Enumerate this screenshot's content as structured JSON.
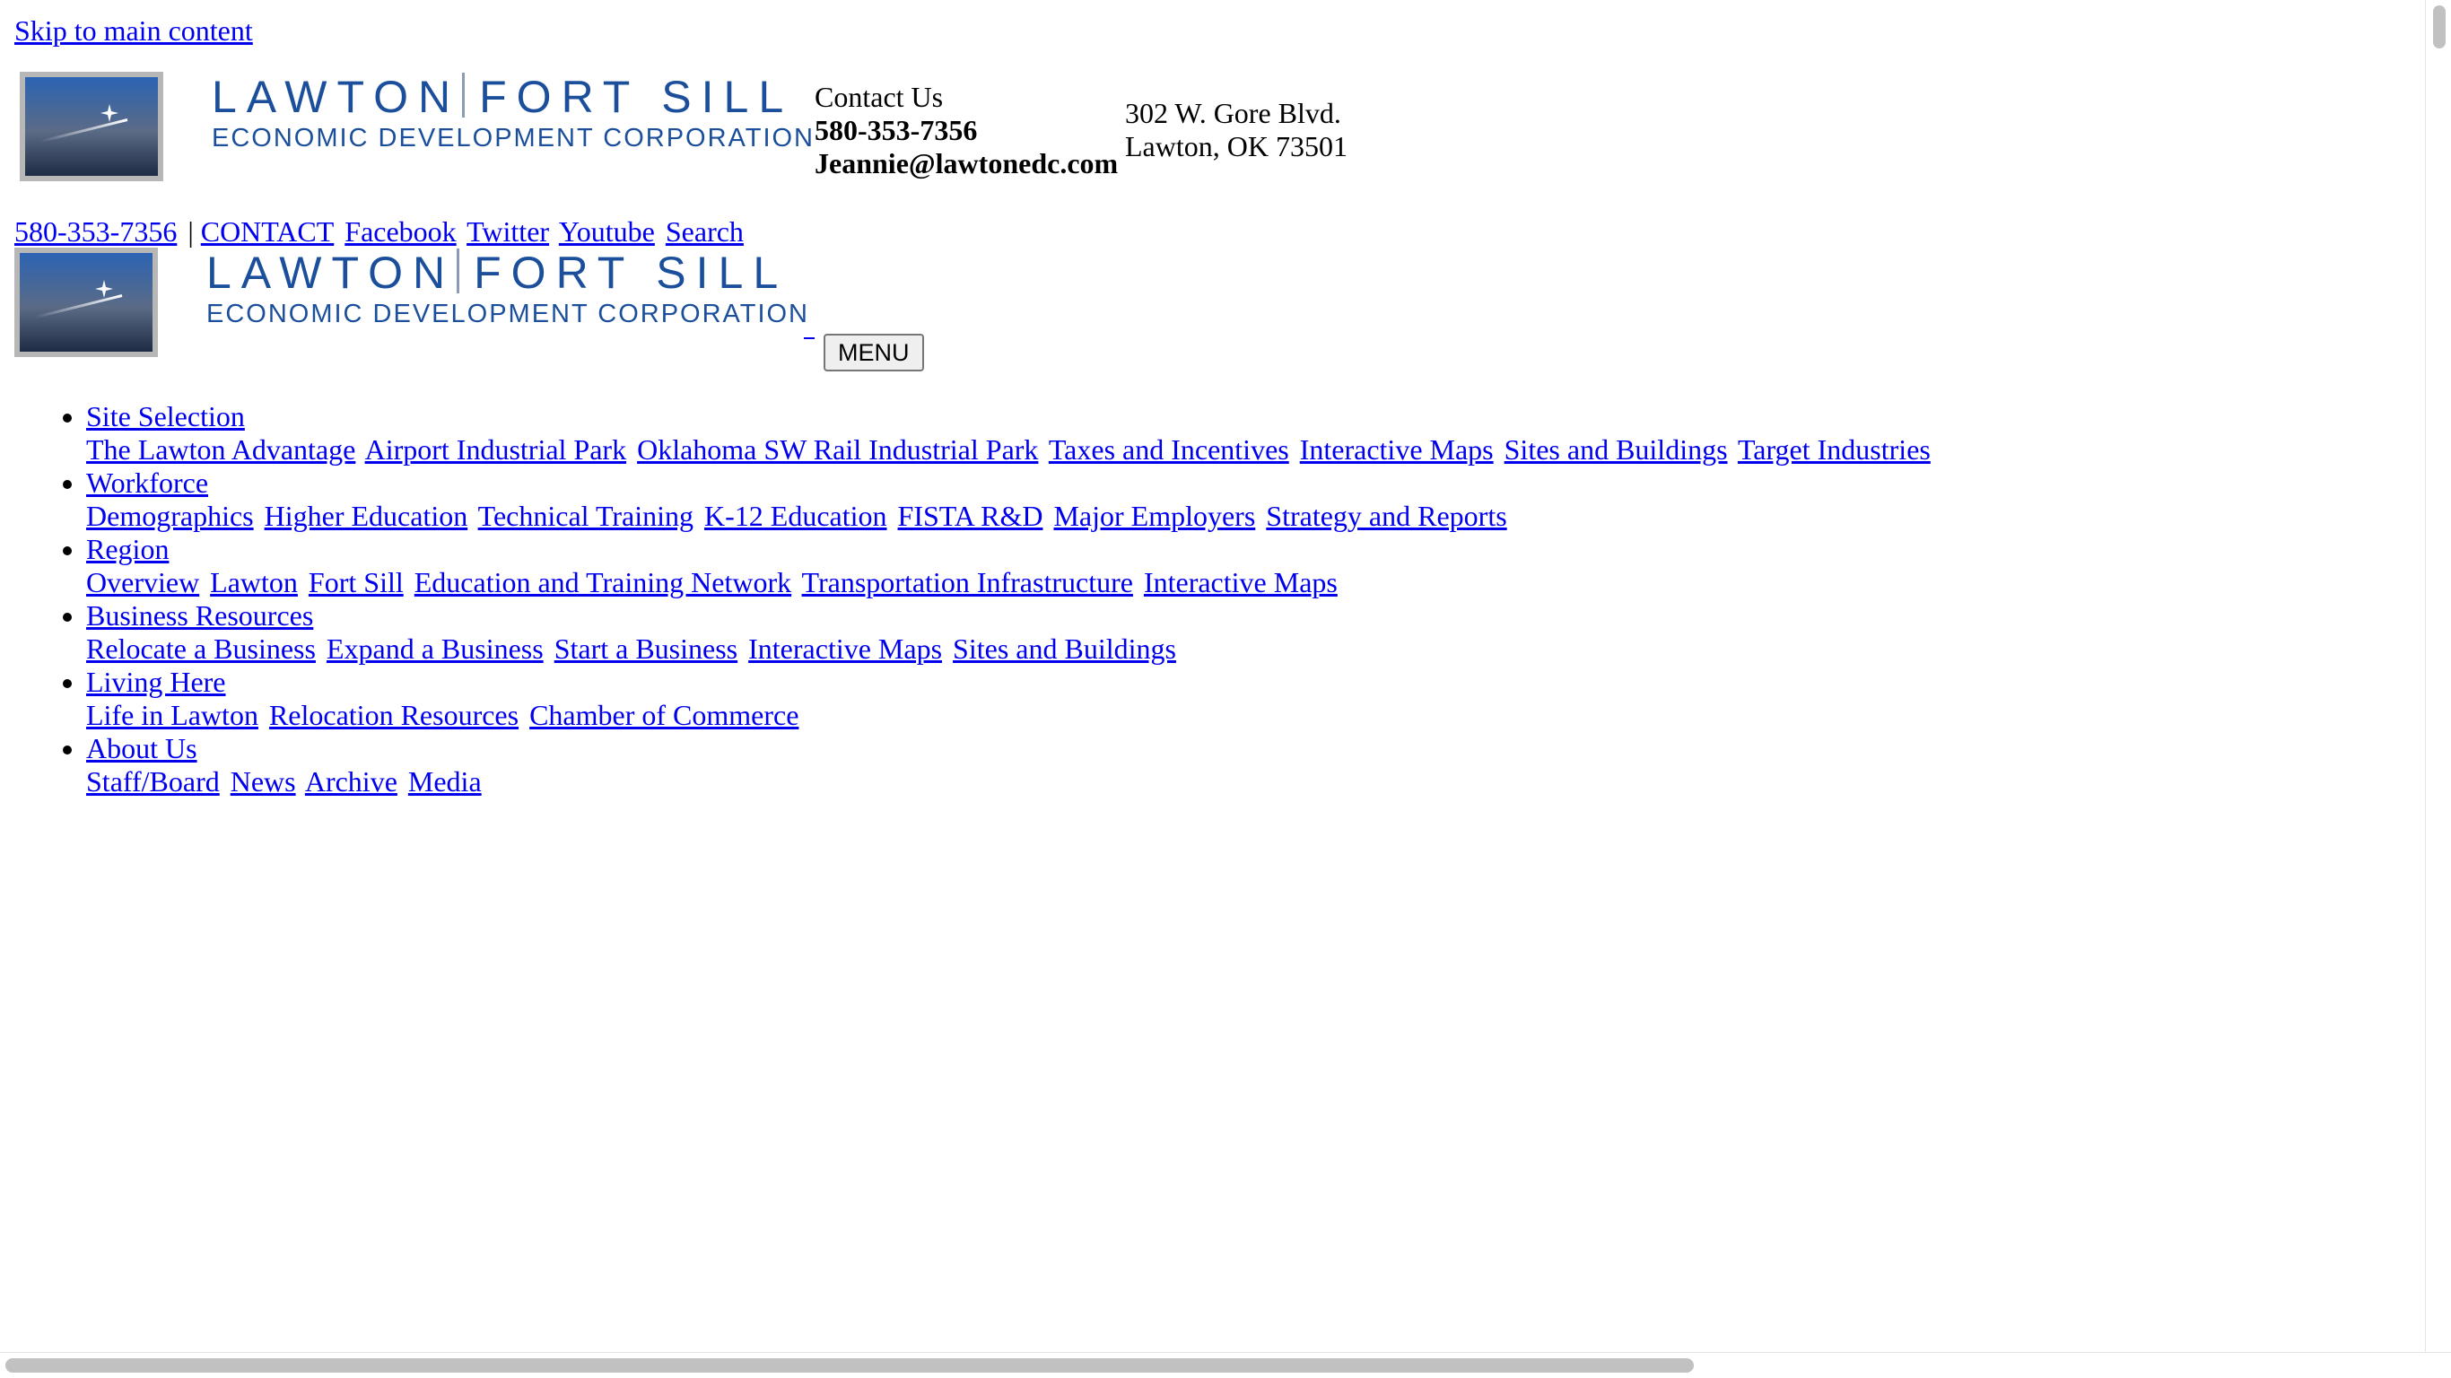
{
  "skip_link": "Skip to main content",
  "header": {
    "logo": {
      "line1_left": "LAWTON",
      "line1_right": "FORT SILL",
      "line2": "ECONOMIC DEVELOPMENT CORPORATION"
    },
    "contact": {
      "heading": "Contact Us",
      "phone": "580-353-7356",
      "email": "Jeannie@lawtonedc.com"
    },
    "address": {
      "line1": "302 W. Gore Blvd.",
      "line2": "Lawton, OK 73501"
    }
  },
  "utility_bar": {
    "phone": "580-353-7356",
    "separator": "|",
    "contact": "CONTACT",
    "facebook": "Facebook",
    "twitter": "Twitter",
    "youtube": "Youtube",
    "search": "Search"
  },
  "menu_button": "MENU",
  "nav": [
    {
      "label": "Site Selection",
      "children": [
        "The Lawton Advantage",
        "Airport Industrial Park",
        "Oklahoma SW Rail Industrial Park",
        "Taxes and Incentives",
        "Interactive Maps",
        "Sites and Buildings",
        "Target Industries"
      ]
    },
    {
      "label": "Workforce",
      "children": [
        "Demographics",
        "Higher Education",
        "Technical Training",
        "K-12 Education",
        "FISTA R&D",
        "Major Employers",
        "Strategy and Reports"
      ]
    },
    {
      "label": "Region",
      "children": [
        "Overview",
        "Lawton",
        "Fort Sill",
        "Education and Training Network",
        "Transportation Infrastructure",
        "Interactive Maps"
      ]
    },
    {
      "label": "Business Resources",
      "children": [
        "Relocate a Business",
        "Expand a Business",
        "Start a Business",
        "Interactive Maps",
        "Sites and Buildings"
      ]
    },
    {
      "label": "Living Here",
      "children": [
        "Life in Lawton",
        "Relocation Resources",
        "Chamber of Commerce"
      ]
    },
    {
      "label": "About Us",
      "children": [
        "Staff/Board",
        "News",
        "Archive",
        "Media"
      ]
    }
  ],
  "colors": {
    "link": "#0000ee",
    "logo_blue": "#1b4f9c",
    "logo_box_border": "#b7b7b7"
  }
}
